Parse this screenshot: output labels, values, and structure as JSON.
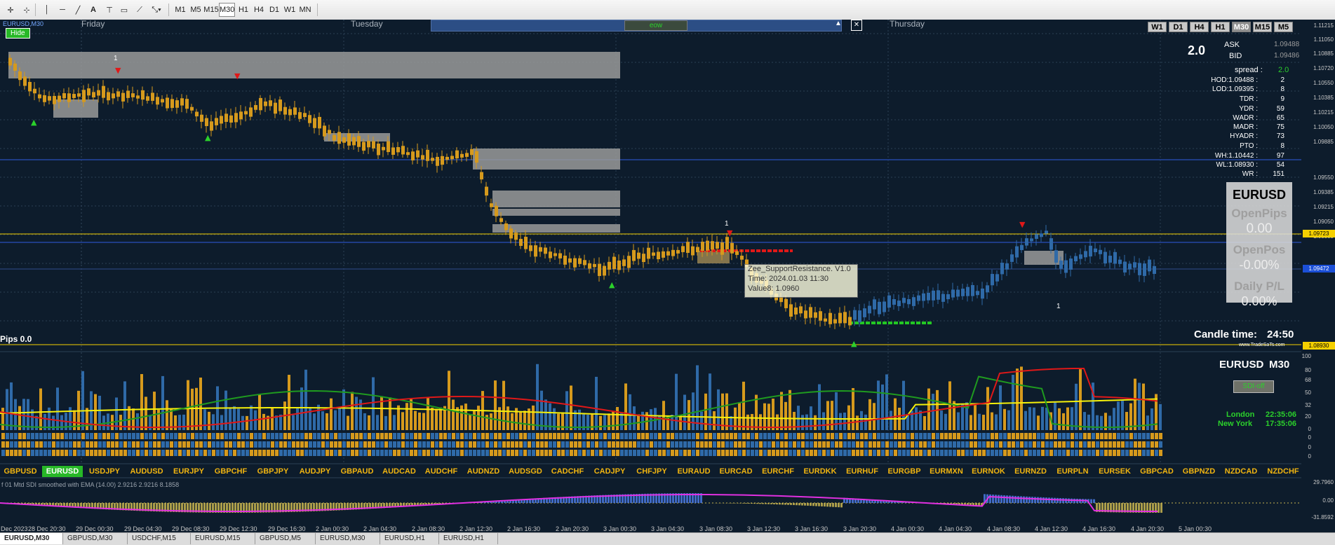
{
  "toolbar": {
    "timeframes": [
      "M1",
      "M5",
      "M15",
      "M30",
      "H1",
      "H4",
      "D1",
      "W1",
      "MN"
    ],
    "selected_timeframe": "M30"
  },
  "chart": {
    "symbol_label": "EURUSD,M30",
    "hide_button": "Hide",
    "day_labels": [
      "Friday",
      "Tuesday",
      "Thursday"
    ],
    "eow_label": "eow",
    "pips_label": "Pips 0.0",
    "tf_buttons": [
      "W1",
      "D1",
      "H4",
      "H1",
      "M30",
      "M15",
      "M5"
    ],
    "active_tf_button": "M30",
    "spread_big": "2.0",
    "ask_label": "ASK",
    "ask_value": "1.09488",
    "bid_label": "BID",
    "bid_value": "1.09486",
    "spread_label": "spread :",
    "spread_value": "2.0",
    "stats": [
      {
        "label": "HOD:1.09488 :",
        "value": "2"
      },
      {
        "label": "LOD:1.09395 :",
        "value": "8"
      },
      {
        "label": "TDR :",
        "value": "9"
      },
      {
        "label": "YDR :",
        "value": "59"
      },
      {
        "label": "WADR :",
        "value": "65"
      },
      {
        "label": "MADR :",
        "value": "75"
      },
      {
        "label": "HYADR :",
        "value": "73"
      },
      {
        "label": "PTO :",
        "value": "8"
      },
      {
        "label": "WH:1.10442 :",
        "value": "97"
      },
      {
        "label": "WL:1.08930 :",
        "value": "54"
      },
      {
        "label": "WR :",
        "value": "151"
      }
    ],
    "panel": {
      "symbol": "EURUSD",
      "open_pips_label": "OpenPips",
      "open_pips_value": "0.00",
      "open_pos_label": "OpenPos",
      "open_pos_value": "-0.00%",
      "daily_pl_label": "Daily P/L",
      "daily_pl_value": "0.00%"
    },
    "candle_time_label": "Candle time:",
    "candle_time_value": "24:50",
    "watermark": "www.TradeSaTs.com",
    "tooltip": {
      "line1": "Zee_SupportResistance. V1.0",
      "line2": "Time: 2024.01.03 11:30",
      "line3": "Value8: 1.0960"
    },
    "price_axis": [
      "1.11215",
      "1.11050",
      "1.10885",
      "1.10720",
      "1.10550",
      "1.10385",
      "1.10215",
      "1.10050",
      "1.09885",
      "1.09550",
      "1.09385",
      "1.09215",
      "1.09050",
      "1.08885"
    ],
    "price_tags": [
      {
        "value": "1.09723",
        "bg": "#f5d000",
        "fg": "#000"
      },
      {
        "value": "1.09472",
        "bg": "#1b4fd8",
        "fg": "#fff"
      },
      {
        "value": "1.08930",
        "bg": "#f5d000",
        "fg": "#000"
      }
    ],
    "marker_one": "1",
    "indicator": {
      "symbol": "EURUSD",
      "timeframe": "M30",
      "sdi_button": "SDI-off",
      "london_label": "London",
      "london_time": "22:35:06",
      "newyork_label": "New York",
      "newyork_time": "17:35:06",
      "axis": [
        "100",
        "80",
        "68",
        "50",
        "32",
        "20",
        "0",
        "0",
        "0",
        "0"
      ]
    },
    "pairs": [
      "GBPUSD",
      "EURUSD",
      "USDJPY",
      "AUDUSD",
      "EURJPY",
      "GBPCHF",
      "GBPJPY",
      "AUDJPY",
      "GBPAUD",
      "AUDCAD",
      "AUDCHF",
      "AUDNZD",
      "AUDSGD",
      "CADCHF",
      "CADJPY",
      "CHFJPY",
      "EURAUD",
      "EURCAD",
      "EURCHF",
      "EURDKK",
      "EURHUF",
      "EURGBP",
      "EURMXN",
      "EURNOK",
      "EURNZD",
      "EURPLN",
      "EURSEK",
      "GBPCAD",
      "GBPNZD",
      "NZDCAD",
      "NZDCHF"
    ],
    "active_pair": "EURUSD",
    "lower_title": "f 01 Mtd SDI smoothed with EMA (14.00) 2.9216 2.9216 8.1858",
    "lower_axis": [
      "29.7960",
      "0.00",
      "-31.8592"
    ],
    "time_axis": [
      "Dec 2023",
      "28 Dec 20:30",
      "29 Dec 00:30",
      "29 Dec 04:30",
      "29 Dec 08:30",
      "29 Dec 12:30",
      "29 Dec 16:30",
      "2 Jan 00:30",
      "2 Jan 04:30",
      "2 Jan 08:30",
      "2 Jan 12:30",
      "2 Jan 16:30",
      "2 Jan 20:30",
      "3 Jan 00:30",
      "3 Jan 04:30",
      "3 Jan 08:30",
      "3 Jan 12:30",
      "3 Jan 16:30",
      "3 Jan 20:30",
      "4 Jan 00:30",
      "4 Jan 04:30",
      "4 Jan 08:30",
      "4 Jan 12:30",
      "4 Jan 16:30",
      "4 Jan 20:30",
      "5 Jan 00:30"
    ]
  },
  "doc_tabs": [
    "EURUSD,M30",
    "GBPUSD,M30",
    "USDCHF,M15",
    "EURUSD,M15",
    "GBPUSD,M5",
    "EURUSD,M30",
    "EURUSD,H1",
    "EURUSD,H1"
  ],
  "active_doc_tab": "EURUSD,M30",
  "colors": {
    "background": "#0d1c2c",
    "bull": "#2f6aa8",
    "bear": "#d69a1d",
    "support": "#23c823",
    "resistance": "#e01818",
    "level": "#f5d000"
  }
}
